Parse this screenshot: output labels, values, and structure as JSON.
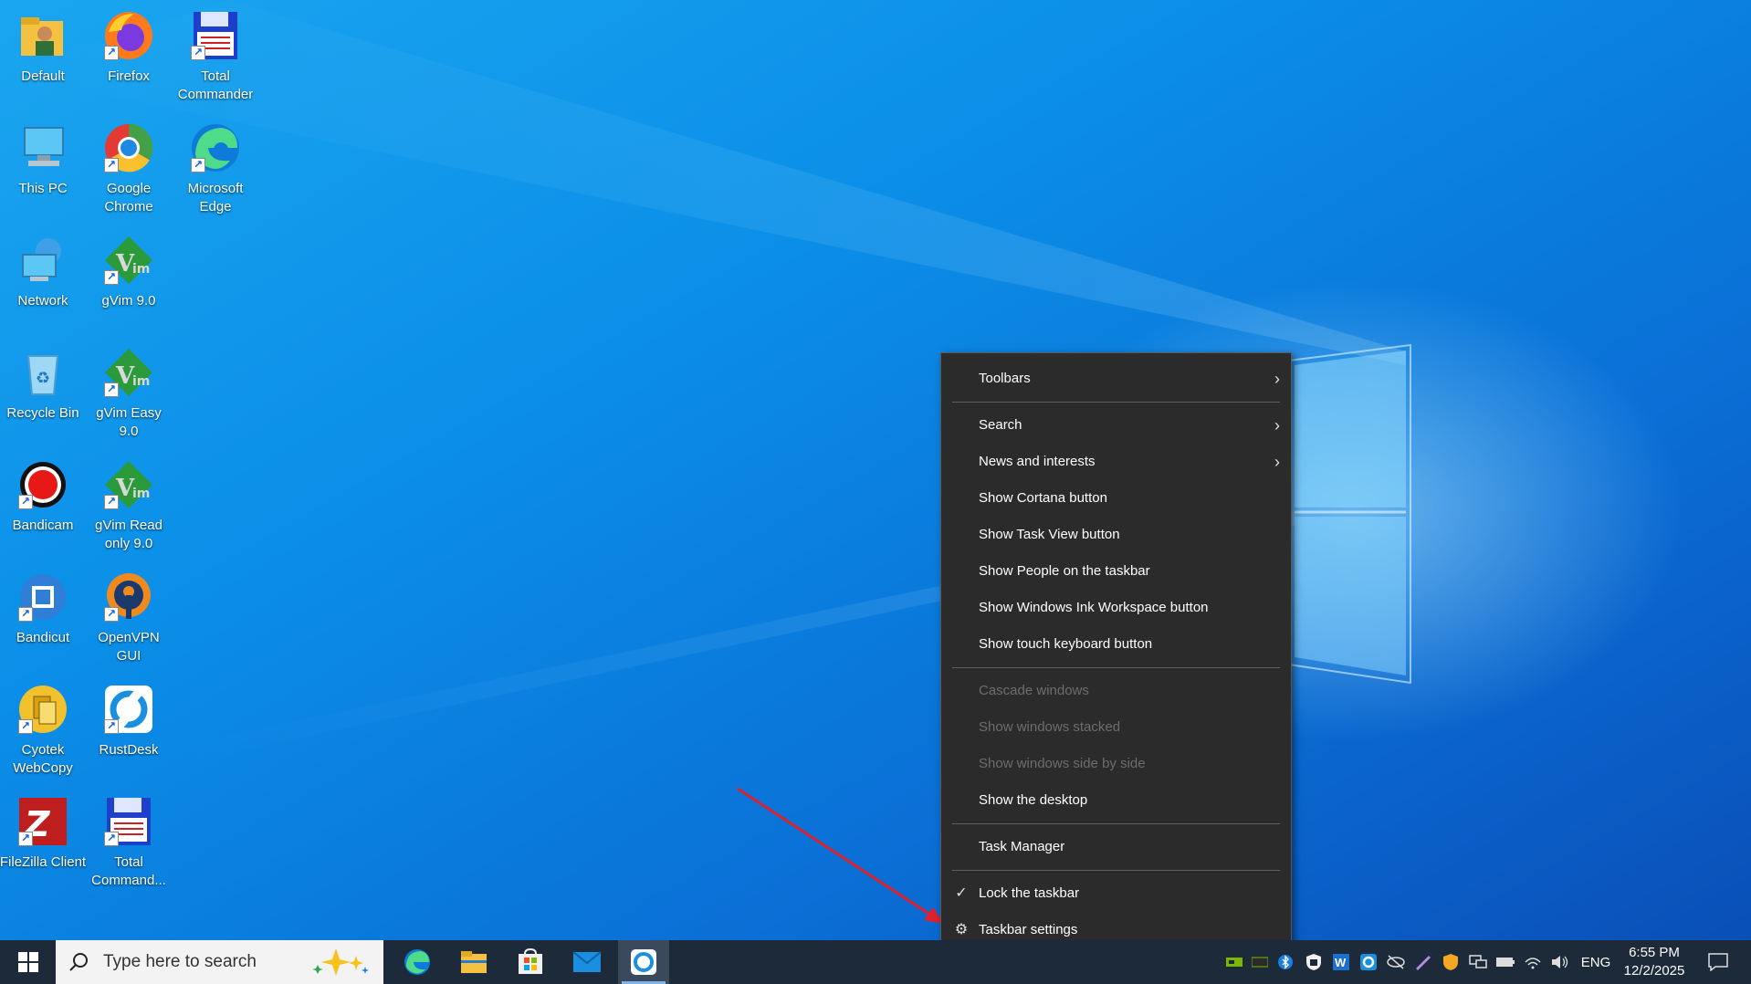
{
  "desktop": {
    "icons": [
      {
        "label": "Default",
        "icon": "user-folder-icon"
      },
      {
        "label": "Firefox",
        "icon": "firefox-icon"
      },
      {
        "label": "Total Commander",
        "icon": "floppy-icon"
      },
      {
        "label": "This PC",
        "icon": "computer-icon"
      },
      {
        "label": "Google Chrome",
        "icon": "chrome-icon"
      },
      {
        "label": "Microsoft Edge",
        "icon": "edge-icon"
      },
      {
        "label": "Network",
        "icon": "network-icon"
      },
      {
        "label": "gVim 9.0",
        "icon": "vim-icon"
      },
      {
        "label": "Recycle Bin",
        "icon": "recycle-bin-icon"
      },
      {
        "label": "gVim Easy 9.0",
        "icon": "vim-icon"
      },
      {
        "label": "Bandicam",
        "icon": "bandicam-icon"
      },
      {
        "label": "gVim Read only 9.0",
        "icon": "vim-icon"
      },
      {
        "label": "Bandicut",
        "icon": "bandicut-icon"
      },
      {
        "label": "OpenVPN GUI",
        "icon": "openvpn-icon"
      },
      {
        "label": "Cyotek WebCopy",
        "icon": "webcopy-icon"
      },
      {
        "label": "RustDesk",
        "icon": "rustdesk-icon"
      },
      {
        "label": "FileZilla Client",
        "icon": "filezilla-icon"
      },
      {
        "label": "Total Command...",
        "icon": "floppy-icon"
      }
    ]
  },
  "context_menu": {
    "items": [
      {
        "label": "Toolbars",
        "submenu": true,
        "disabled": false
      },
      {
        "label": "Search",
        "submenu": true,
        "disabled": false
      },
      {
        "label": "News and interests",
        "submenu": true,
        "disabled": false
      },
      {
        "label": "Show Cortana button",
        "disabled": false
      },
      {
        "label": "Show Task View button",
        "disabled": false
      },
      {
        "label": "Show People on the taskbar",
        "disabled": false
      },
      {
        "label": "Show Windows Ink Workspace button",
        "disabled": false
      },
      {
        "label": "Show touch keyboard button",
        "disabled": false
      },
      {
        "label": "Cascade windows",
        "disabled": true
      },
      {
        "label": "Show windows stacked",
        "disabled": true
      },
      {
        "label": "Show windows side by side",
        "disabled": true
      },
      {
        "label": "Show the desktop",
        "disabled": false
      },
      {
        "label": "Task Manager",
        "disabled": false
      },
      {
        "label": "Lock the taskbar",
        "checked": true,
        "disabled": false
      },
      {
        "label": "Taskbar settings",
        "icon": "gear-icon",
        "disabled": false
      }
    ]
  },
  "taskbar": {
    "search_placeholder": "Type here to search",
    "pinned": [
      "edge-icon",
      "file-explorer-icon",
      "store-icon",
      "mail-icon",
      "rustdesk-icon"
    ],
    "language": "ENG",
    "time": "6:55 PM",
    "date": "12/2/2025"
  },
  "colors": {
    "taskbar_bg": "#1c2a3a",
    "menu_bg": "#2b2b2b",
    "annotation_arrow": "#e0202a"
  }
}
